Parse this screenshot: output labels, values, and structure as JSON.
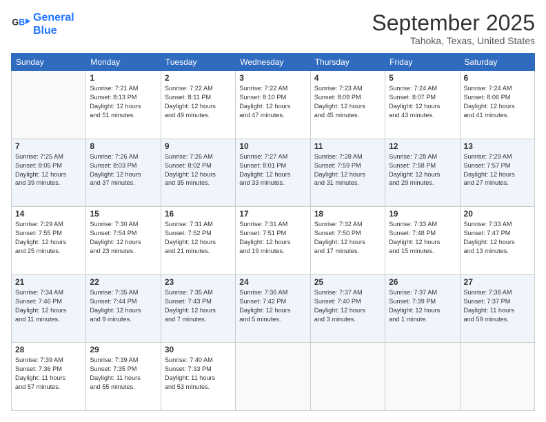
{
  "header": {
    "logo": {
      "line1": "General",
      "line2": "Blue"
    },
    "title": "September 2025",
    "subtitle": "Tahoka, Texas, United States"
  },
  "weekdays": [
    "Sunday",
    "Monday",
    "Tuesday",
    "Wednesday",
    "Thursday",
    "Friday",
    "Saturday"
  ],
  "weeks": [
    [
      {
        "day": "",
        "info": ""
      },
      {
        "day": "1",
        "info": "Sunrise: 7:21 AM\nSunset: 8:13 PM\nDaylight: 12 hours\nand 51 minutes."
      },
      {
        "day": "2",
        "info": "Sunrise: 7:22 AM\nSunset: 8:11 PM\nDaylight: 12 hours\nand 49 minutes."
      },
      {
        "day": "3",
        "info": "Sunrise: 7:22 AM\nSunset: 8:10 PM\nDaylight: 12 hours\nand 47 minutes."
      },
      {
        "day": "4",
        "info": "Sunrise: 7:23 AM\nSunset: 8:09 PM\nDaylight: 12 hours\nand 45 minutes."
      },
      {
        "day": "5",
        "info": "Sunrise: 7:24 AM\nSunset: 8:07 PM\nDaylight: 12 hours\nand 43 minutes."
      },
      {
        "day": "6",
        "info": "Sunrise: 7:24 AM\nSunset: 8:06 PM\nDaylight: 12 hours\nand 41 minutes."
      }
    ],
    [
      {
        "day": "7",
        "info": "Sunrise: 7:25 AM\nSunset: 8:05 PM\nDaylight: 12 hours\nand 39 minutes."
      },
      {
        "day": "8",
        "info": "Sunrise: 7:26 AM\nSunset: 8:03 PM\nDaylight: 12 hours\nand 37 minutes."
      },
      {
        "day": "9",
        "info": "Sunrise: 7:26 AM\nSunset: 8:02 PM\nDaylight: 12 hours\nand 35 minutes."
      },
      {
        "day": "10",
        "info": "Sunrise: 7:27 AM\nSunset: 8:01 PM\nDaylight: 12 hours\nand 33 minutes."
      },
      {
        "day": "11",
        "info": "Sunrise: 7:28 AM\nSunset: 7:59 PM\nDaylight: 12 hours\nand 31 minutes."
      },
      {
        "day": "12",
        "info": "Sunrise: 7:28 AM\nSunset: 7:58 PM\nDaylight: 12 hours\nand 29 minutes."
      },
      {
        "day": "13",
        "info": "Sunrise: 7:29 AM\nSunset: 7:57 PM\nDaylight: 12 hours\nand 27 minutes."
      }
    ],
    [
      {
        "day": "14",
        "info": "Sunrise: 7:29 AM\nSunset: 7:55 PM\nDaylight: 12 hours\nand 25 minutes."
      },
      {
        "day": "15",
        "info": "Sunrise: 7:30 AM\nSunset: 7:54 PM\nDaylight: 12 hours\nand 23 minutes."
      },
      {
        "day": "16",
        "info": "Sunrise: 7:31 AM\nSunset: 7:52 PM\nDaylight: 12 hours\nand 21 minutes."
      },
      {
        "day": "17",
        "info": "Sunrise: 7:31 AM\nSunset: 7:51 PM\nDaylight: 12 hours\nand 19 minutes."
      },
      {
        "day": "18",
        "info": "Sunrise: 7:32 AM\nSunset: 7:50 PM\nDaylight: 12 hours\nand 17 minutes."
      },
      {
        "day": "19",
        "info": "Sunrise: 7:33 AM\nSunset: 7:48 PM\nDaylight: 12 hours\nand 15 minutes."
      },
      {
        "day": "20",
        "info": "Sunrise: 7:33 AM\nSunset: 7:47 PM\nDaylight: 12 hours\nand 13 minutes."
      }
    ],
    [
      {
        "day": "21",
        "info": "Sunrise: 7:34 AM\nSunset: 7:46 PM\nDaylight: 12 hours\nand 11 minutes."
      },
      {
        "day": "22",
        "info": "Sunrise: 7:35 AM\nSunset: 7:44 PM\nDaylight: 12 hours\nand 9 minutes."
      },
      {
        "day": "23",
        "info": "Sunrise: 7:35 AM\nSunset: 7:43 PM\nDaylight: 12 hours\nand 7 minutes."
      },
      {
        "day": "24",
        "info": "Sunrise: 7:36 AM\nSunset: 7:42 PM\nDaylight: 12 hours\nand 5 minutes."
      },
      {
        "day": "25",
        "info": "Sunrise: 7:37 AM\nSunset: 7:40 PM\nDaylight: 12 hours\nand 3 minutes."
      },
      {
        "day": "26",
        "info": "Sunrise: 7:37 AM\nSunset: 7:39 PM\nDaylight: 12 hours\nand 1 minute."
      },
      {
        "day": "27",
        "info": "Sunrise: 7:38 AM\nSunset: 7:37 PM\nDaylight: 11 hours\nand 59 minutes."
      }
    ],
    [
      {
        "day": "28",
        "info": "Sunrise: 7:39 AM\nSunset: 7:36 PM\nDaylight: 11 hours\nand 57 minutes."
      },
      {
        "day": "29",
        "info": "Sunrise: 7:39 AM\nSunset: 7:35 PM\nDaylight: 11 hours\nand 55 minutes."
      },
      {
        "day": "30",
        "info": "Sunrise: 7:40 AM\nSunset: 7:33 PM\nDaylight: 11 hours\nand 53 minutes."
      },
      {
        "day": "",
        "info": ""
      },
      {
        "day": "",
        "info": ""
      },
      {
        "day": "",
        "info": ""
      },
      {
        "day": "",
        "info": ""
      }
    ]
  ]
}
